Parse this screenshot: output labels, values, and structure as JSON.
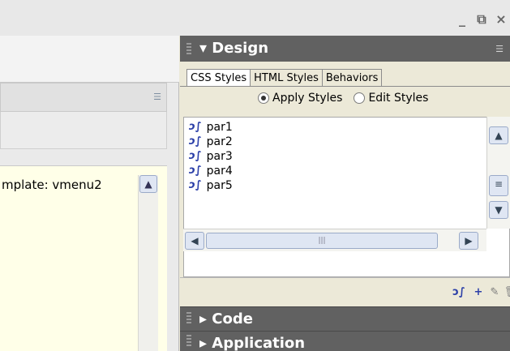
{
  "window": {
    "minimize_glyph": "_",
    "restore_glyph": "⧉",
    "close_glyph": "×"
  },
  "document": {
    "template_line": "mplate: vmenu2"
  },
  "design_panel": {
    "title": "▾ Design",
    "tabs": [
      {
        "label": "CSS Styles",
        "active": true
      },
      {
        "label": "HTML Styles",
        "active": false
      },
      {
        "label": "Behaviors",
        "active": false
      }
    ],
    "radios": [
      {
        "label": "Apply Styles",
        "selected": true
      },
      {
        "label": "Edit Styles",
        "selected": false
      }
    ],
    "styles": [
      "par1",
      "par2",
      "par3",
      "par4",
      "par5"
    ],
    "style_icon": "css-style-icon"
  },
  "collapsed_panels": [
    {
      "title": "▸ Code"
    },
    {
      "title": "▸ Application"
    }
  ],
  "colors": {
    "panel_header": "#616161",
    "panel_body": "#ece9d8",
    "doc_bg": "#ffffe8",
    "icon_blue": "#2b3fa8"
  }
}
